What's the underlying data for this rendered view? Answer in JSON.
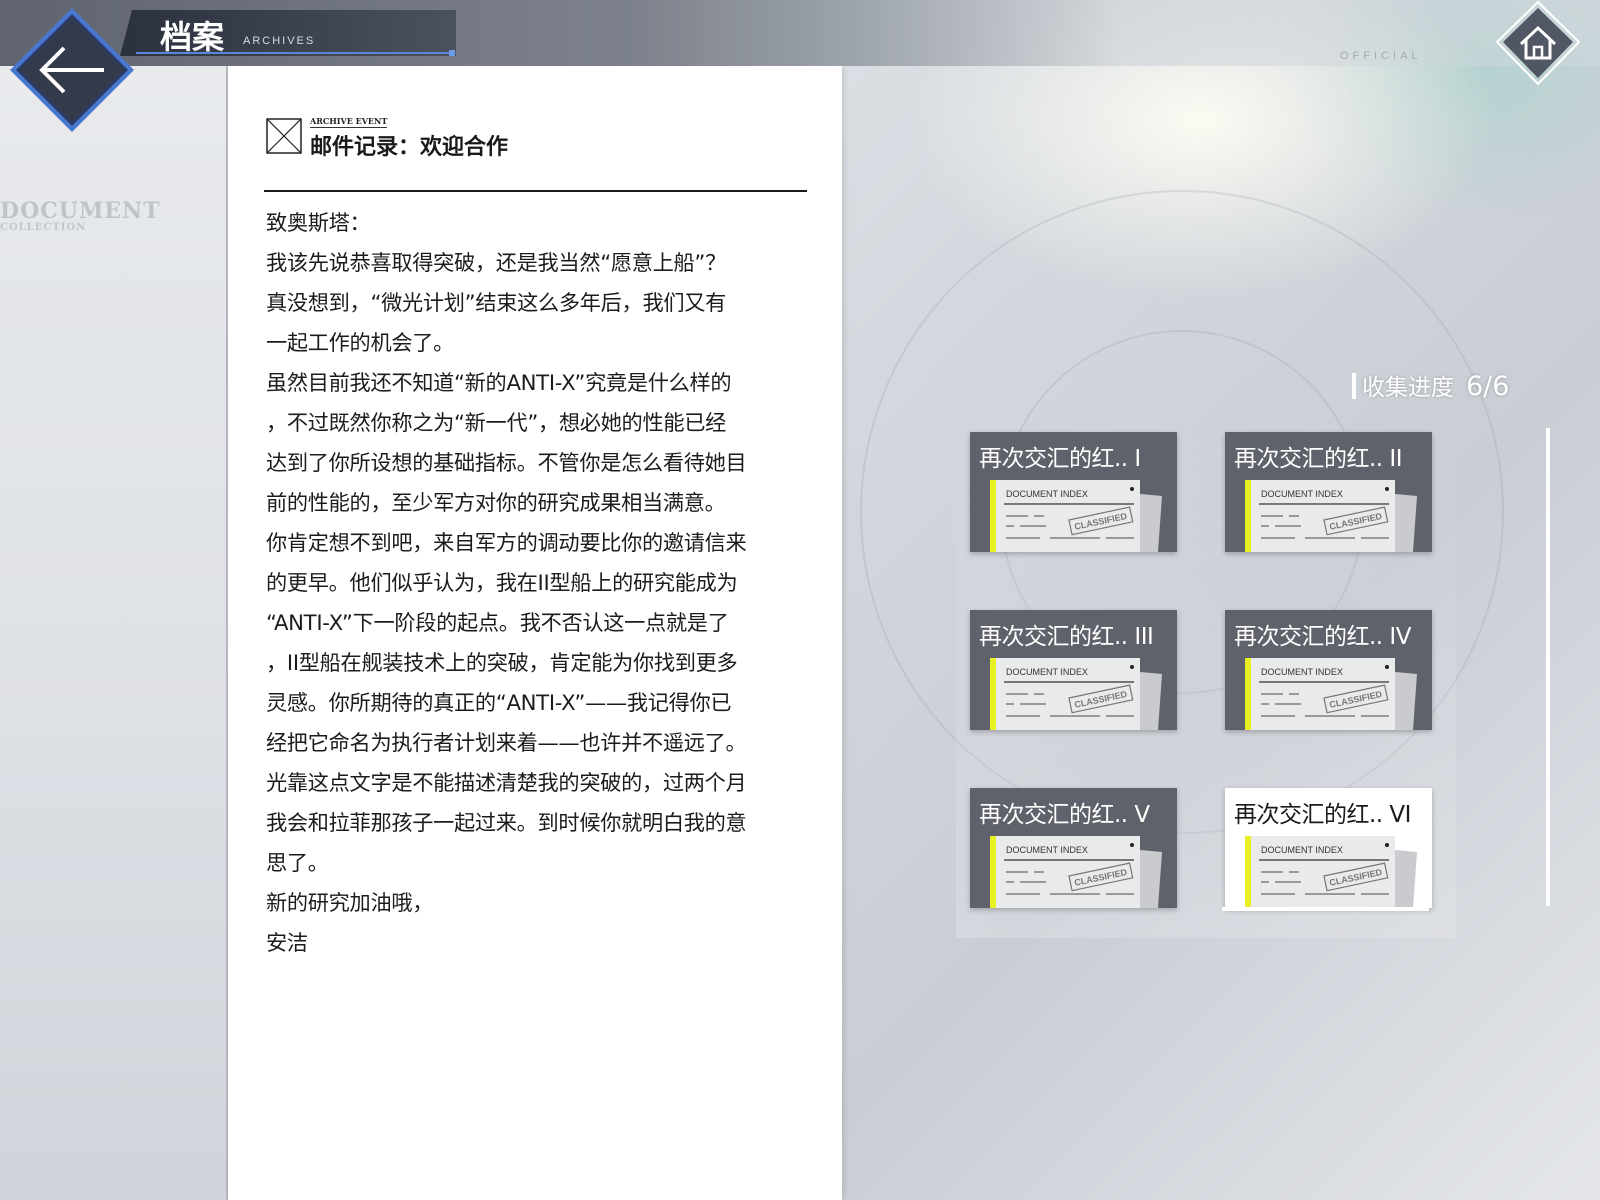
{
  "header": {
    "title": "档案",
    "subtitle": "ARCHIVES",
    "watermark": "OFFICIAL"
  },
  "sidebar": {
    "watermark_title": "DOCUMENT",
    "watermark_sub": "COLLECTION"
  },
  "document": {
    "tag": "ARCHIVE EVENT",
    "title": "邮件记录：欢迎合作",
    "lines": [
      "致奥斯塔：",
      "我该先说恭喜取得突破，还是我当然“愿意上船”？",
      "真没想到，“微光计划”结束这么多年后，我们又有",
      "一起工作的机会了。",
      "虽然目前我还不知道“新的ANTI-X”究竟是什么样的",
      "，不过既然你称之为“新一代”，想必她的性能已经",
      "达到了你所设想的基础指标。不管你是怎么看待她目",
      "前的性能的，至少军方对你的研究成果相当满意。",
      "你肯定想不到吧，来自军方的调动要比你的邀请信来",
      "的更早。他们似乎认为，我在II型船上的研究能成为",
      "“ANTI-X”下一阶段的起点。我不否认这一点就是了",
      "，II型船在舰装技术上的突破，肯定能为你找到更多",
      "灵感。你所期待的真正的“ANTI-X”——我记得你已",
      "经把它命名为执行者计划来着——也许并不遥远了。",
      "光靠这点文字是不能描述清楚我的突破的，过两个月",
      "我会和拉菲那孩子一起过来。到时候你就明白我的意",
      "思了。",
      "新的研究加油哦，",
      "安洁"
    ]
  },
  "progress": {
    "label": "收集进度",
    "value": "6/6"
  },
  "cards": [
    {
      "label": "再次交汇的红.. I",
      "thumb_header": "DOCUMENT INDEX",
      "stamp": "CLASSIFIED",
      "selected": false
    },
    {
      "label": "再次交汇的红.. II",
      "thumb_header": "DOCUMENT INDEX",
      "stamp": "CLASSIFIED",
      "selected": false
    },
    {
      "label": "再次交汇的红.. III",
      "thumb_header": "DOCUMENT INDEX",
      "stamp": "CLASSIFIED",
      "selected": false
    },
    {
      "label": "再次交汇的红.. IV",
      "thumb_header": "DOCUMENT INDEX",
      "stamp": "CLASSIFIED",
      "selected": false
    },
    {
      "label": "再次交汇的红.. V",
      "thumb_header": "DOCUMENT INDEX",
      "stamp": "CLASSIFIED",
      "selected": false
    },
    {
      "label": "再次交汇的红.. VI",
      "thumb_header": "DOCUMENT INDEX",
      "stamp": "CLASSIFIED",
      "selected": true
    }
  ],
  "colors": {
    "accent_blue": "#5a86d6",
    "thumb_accent": "#e6f023",
    "card_bg": "#5f626a",
    "card_selected_bg": "#ffffff"
  },
  "icons": {
    "back": "arrow-left-icon",
    "home": "home-icon",
    "mail": "mail-icon"
  }
}
